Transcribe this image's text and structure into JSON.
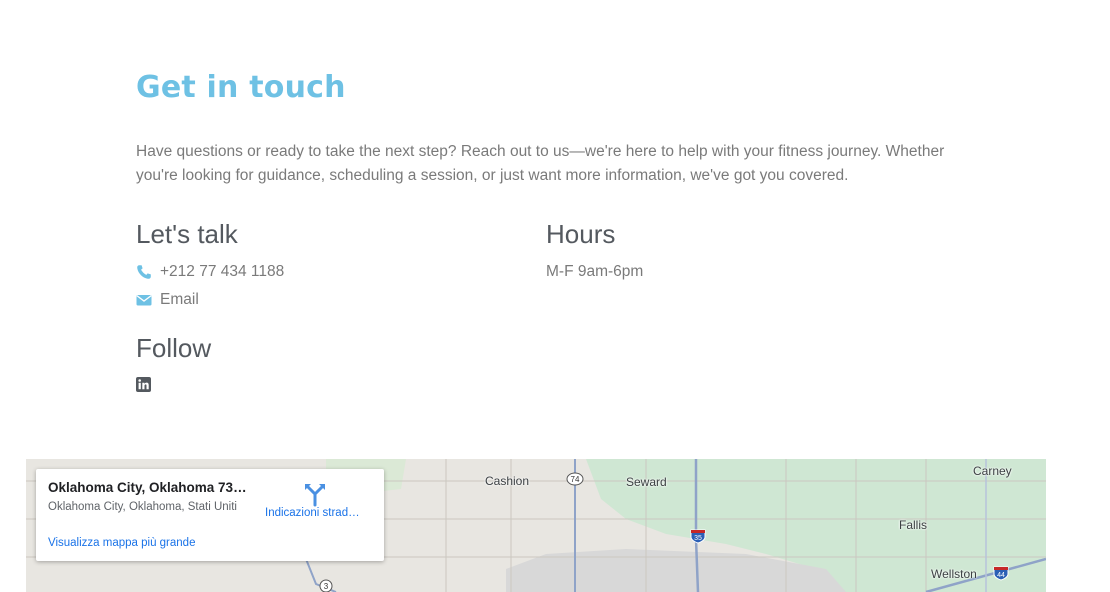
{
  "header": {
    "title": "Get in touch",
    "intro": "Have questions or ready to take the next step? Reach out to us—we're here to help with your fitness journey. Whether you're looking for guidance, scheduling a session, or just want more information, we've got you covered."
  },
  "talk": {
    "title": "Let's talk",
    "phone": "+212 77 434 1188",
    "email": "Email"
  },
  "hours": {
    "title": "Hours",
    "text": "M-F 9am-6pm"
  },
  "follow": {
    "title": "Follow",
    "icon": "linkedin-icon"
  },
  "colors": {
    "accent": "#6ec1e4",
    "heading": "#54595f",
    "text": "#7a7a7a",
    "link": "#1a73e8"
  },
  "map": {
    "place_name": "Oklahoma City, Oklahoma 731…",
    "place_address": "Oklahoma City, Oklahoma, Stati Uniti",
    "directions_label": "Indicazioni strad…",
    "larger_map_link": "Visualizza mappa più grande",
    "labels": {
      "cashion": "Cashion",
      "seward": "Seward",
      "carney": "Carney",
      "fallis": "Fallis",
      "wellston": "Wellston"
    },
    "shields": {
      "r74": "74",
      "i35": "35",
      "i44": "44",
      "r3": "3"
    }
  }
}
